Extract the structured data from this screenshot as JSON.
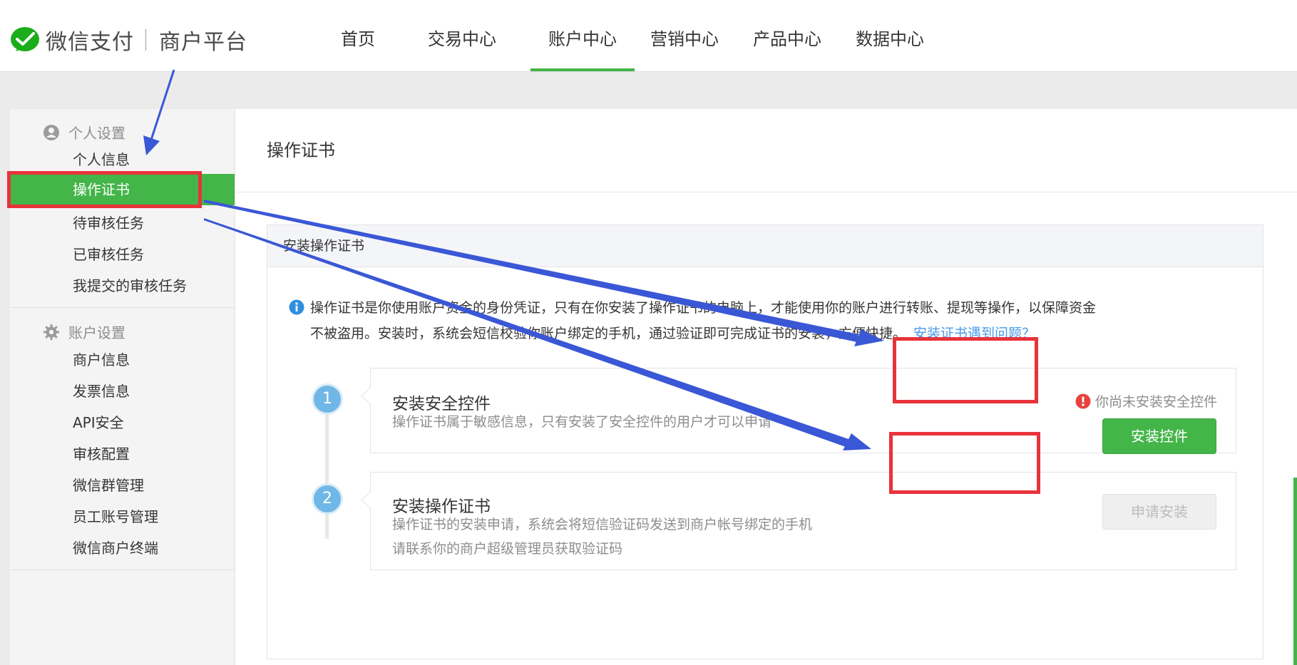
{
  "header": {
    "brand": "微信支付",
    "platform": "商户平台",
    "nav": [
      {
        "label": "首页",
        "active": false
      },
      {
        "label": "交易中心",
        "active": false
      },
      {
        "label": "账户中心",
        "active": true
      },
      {
        "label": "营销中心",
        "active": false
      },
      {
        "label": "产品中心",
        "active": false
      },
      {
        "label": "数据中心",
        "active": false
      }
    ]
  },
  "sidebar": {
    "personal_group": "个人设置",
    "personal_items": [
      "个人信息",
      "操作证书",
      "待审核任务",
      "已审核任务",
      "我提交的审核任务"
    ],
    "account_group": "账户设置",
    "account_items": [
      "商户信息",
      "发票信息",
      "API安全",
      "审核配置",
      "微信群管理",
      "员工账号管理",
      "微信商户终端"
    ]
  },
  "main": {
    "title": "操作证书",
    "panel_title": "安装操作证书",
    "intro_line1": "操作证书是你使用账户资金的身份凭证，只有在你安装了操作证书的电脑上，才能使用你的账户进行转账、提现等操作，以保障资金",
    "intro_line2": "不被盗用。安装时，系统会短信校验你账户绑定的手机，通过验证即可完成证书的安装，方便快捷。",
    "help_link": "安装证书遇到问题？",
    "steps": [
      {
        "number": "1",
        "title": "安装安全控件",
        "desc": "操作证书属于敏感信息，只有安装了安全控件的用户才可以申请",
        "warning": "你尚未安装安全控件",
        "button": "安装控件"
      },
      {
        "number": "2",
        "title": "安装操作证书",
        "desc_line1": "操作证书的安装申请，系统会将短信验证码发送到商户帐号绑定的手机",
        "desc_line2": "请联系你的商户超级管理员获取验证码",
        "button": "申请安装"
      }
    ]
  },
  "colors": {
    "brand_green": "#44b549",
    "annotation_red": "#e8333a",
    "annotation_blue": "#3a57d6",
    "link_blue": "#459ae9",
    "warning_red": "#e64340"
  }
}
